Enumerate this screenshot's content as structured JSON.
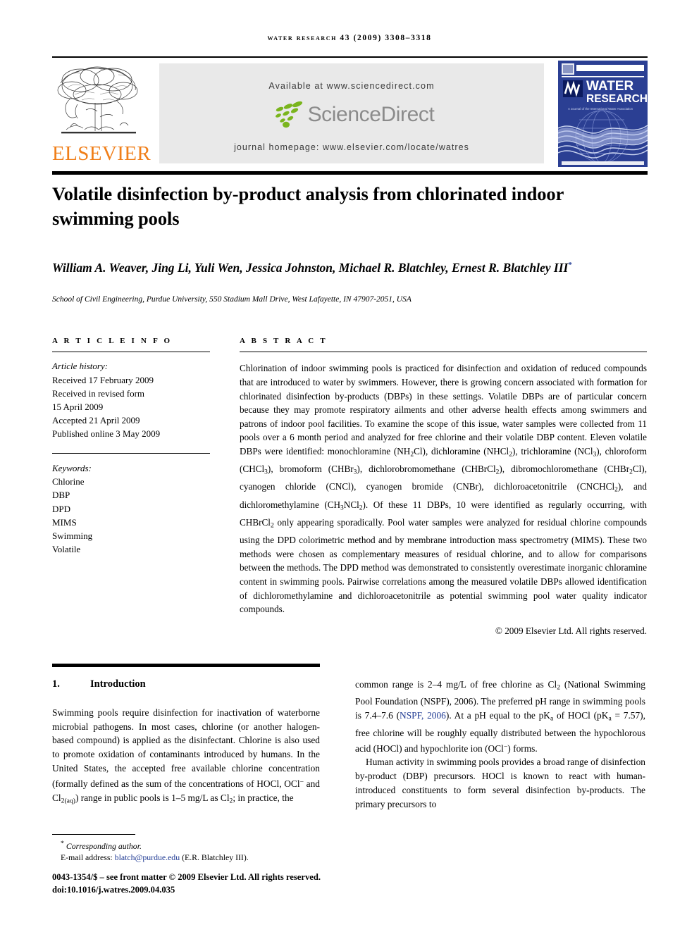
{
  "running_head": "WATER RESEARCH 43 (2009) 3308–3318",
  "banner": {
    "publisher": "ELSEVIER",
    "available_at": "Available at www.sciencedirect.com",
    "sciencedirect": "ScienceDirect",
    "journal_homepage": "journal homepage: www.elsevier.com/locate/watres",
    "cover": {
      "line1": "WATER",
      "line2": "RESEARCH",
      "tagline": "A Journal of the International Water Association",
      "iwa": "IWA"
    },
    "colors": {
      "elsevier_orange": "#F07F1A",
      "sciencedirect_gray": "#8b8b8b",
      "sciencedirect_green": "#7ab51d",
      "cover_blue": "#2b3f93",
      "panel_gray": "#e9e9e9"
    }
  },
  "title": "Volatile disinfection by-product analysis from chlorinated indoor swimming pools",
  "authors": "William A. Weaver, Jing Li, Yuli Wen, Jessica Johnston, Michael R. Blatchley, Ernest R. Blatchley III",
  "author_marker": "*",
  "affiliation": "School of Civil Engineering, Purdue University, 550 Stadium Mall Drive, West Lafayette, IN 47907-2051, USA",
  "article_info": {
    "heading": "A R T I C L E   I N F O",
    "history_label": "Article history:",
    "history": [
      "Received 17 February 2009",
      "Received in revised form",
      "15 April 2009",
      "Accepted 21 April 2009",
      "Published online 3 May 2009"
    ],
    "keywords_label": "Keywords:",
    "keywords": [
      "Chlorine",
      "DBP",
      "DPD",
      "MIMS",
      "Swimming",
      "Volatile"
    ]
  },
  "abstract": {
    "heading": "A B S T R A C T",
    "copyright": "© 2009 Elsevier Ltd. All rights reserved."
  },
  "introduction": {
    "number": "1.",
    "heading": "Introduction"
  },
  "footnote": {
    "corresponding": "Corresponding author.",
    "marker": "*",
    "email_label": "E-mail address:",
    "email": "blatch@purdue.edu",
    "email_owner": "(E.R. Blatchley III).",
    "issn_line": "0043-1354/$ – see front matter © 2009 Elsevier Ltd. All rights reserved.",
    "doi": "doi:10.1016/j.watres.2009.04.035"
  },
  "citations": {
    "nspf": "NSPF, 2006"
  }
}
